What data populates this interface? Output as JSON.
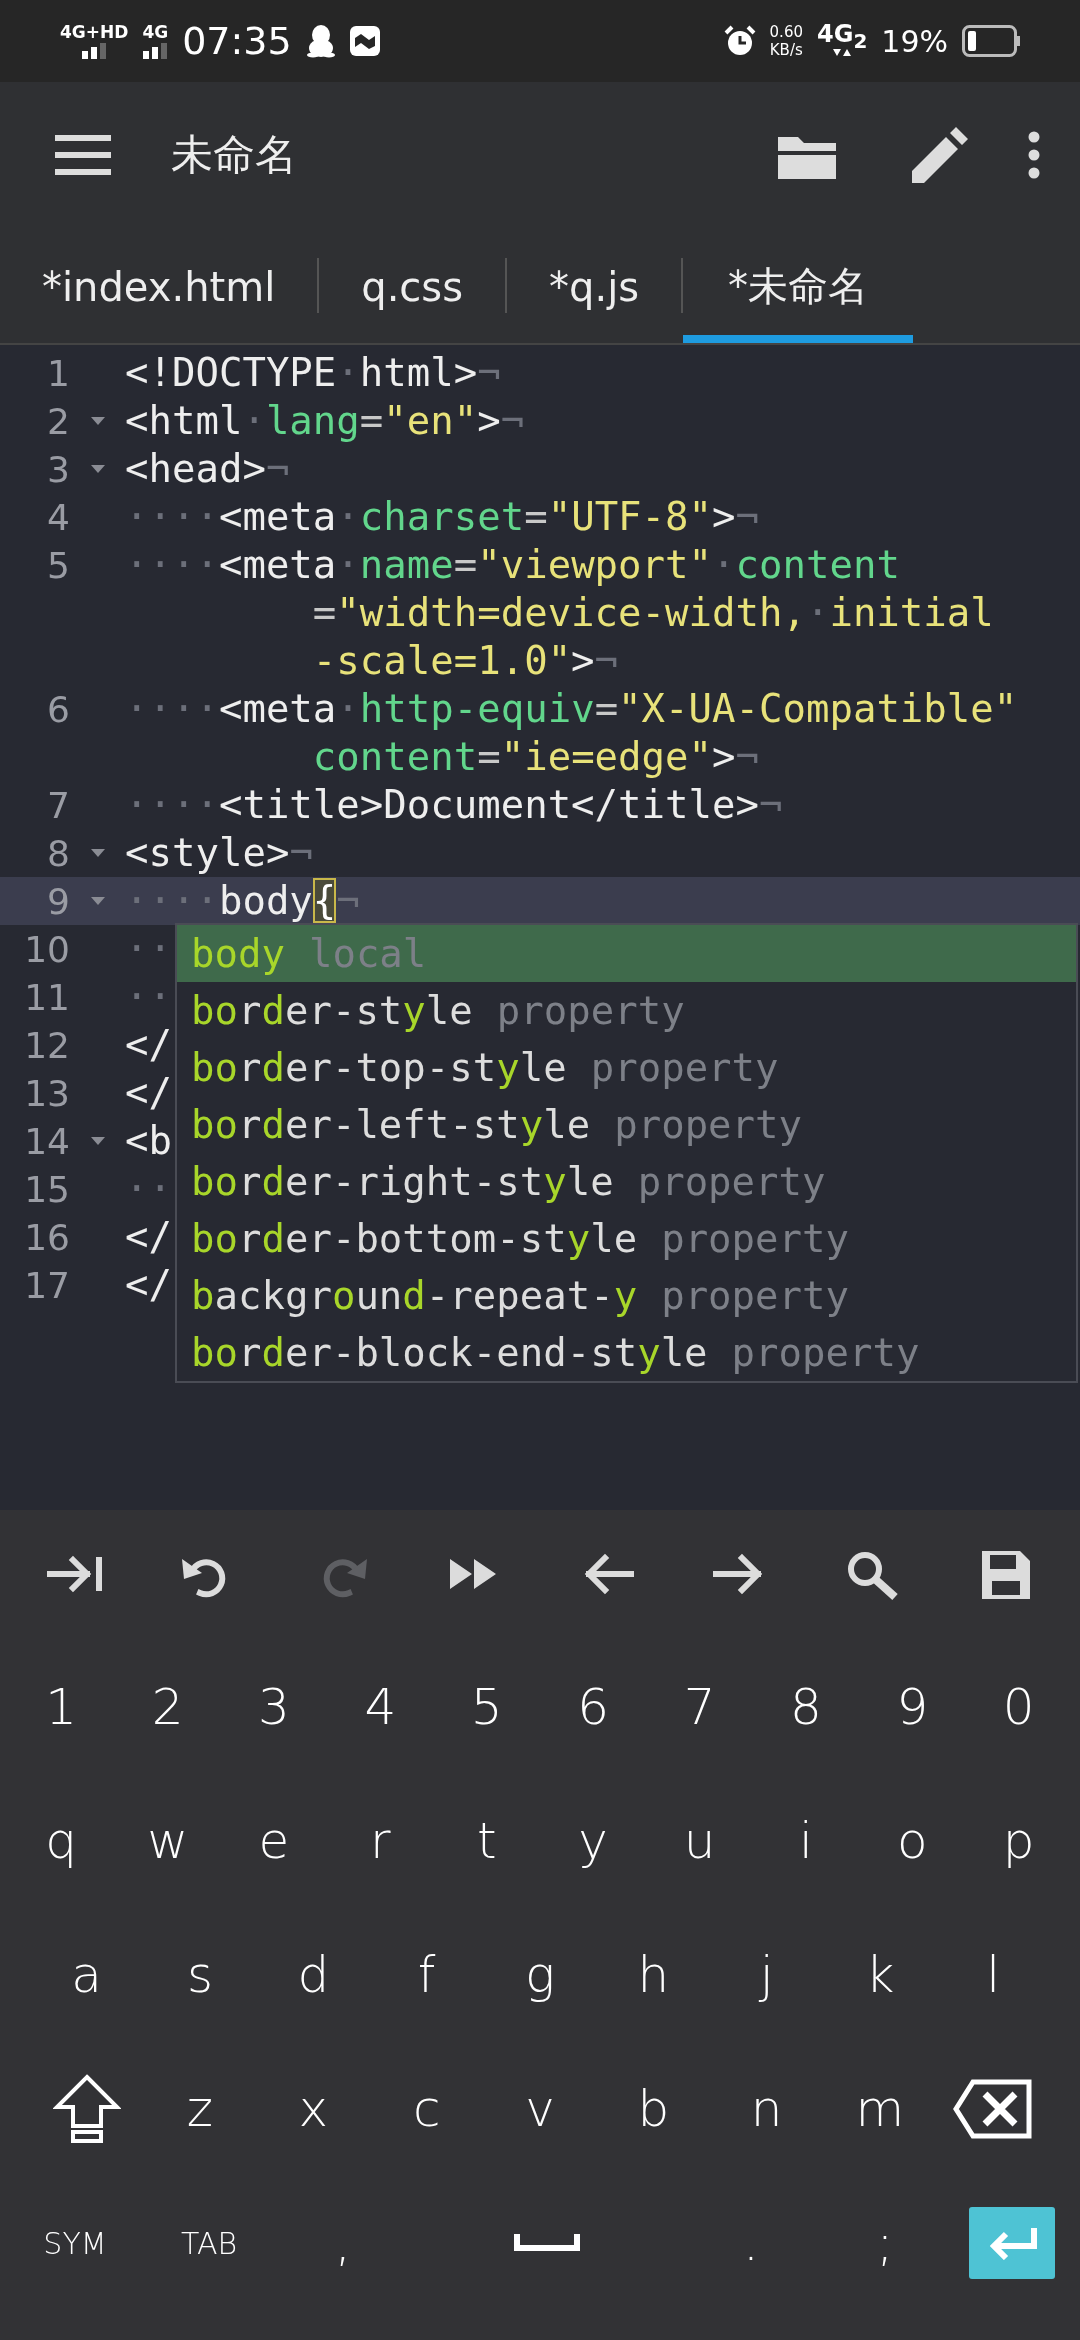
{
  "status_bar": {
    "sim1": "4G+HD",
    "sim2": "4G",
    "time": "07:35",
    "speed": "0.60",
    "speed_unit": "KB/s",
    "network": "4G$_{2}$",
    "battery": "19%"
  },
  "toolbar": {
    "title": "未命名"
  },
  "tabs": [
    {
      "label": "*index.html",
      "selected": false
    },
    {
      "label": "q.css",
      "selected": false
    },
    {
      "label": "*q.js",
      "selected": false
    },
    {
      "label": "*未命名",
      "selected": true
    }
  ],
  "editor": {
    "lines": [
      {
        "number": "1",
        "fold": false,
        "current": false,
        "rows": [
          {
            "tokens": [
              {
                "kind": "tag",
                "text": "<!DOCTYPE"
              },
              {
                "kind": "ws",
                "text": "·"
              },
              {
                "kind": "tag",
                "text": "html>"
              },
              {
                "kind": "eol",
                "text": "¬"
              }
            ]
          }
        ]
      },
      {
        "number": "2",
        "fold": true,
        "current": false,
        "rows": [
          {
            "tokens": [
              {
                "kind": "tag",
                "text": "<html"
              },
              {
                "kind": "ws",
                "text": "·"
              },
              {
                "kind": "attr",
                "text": "lang"
              },
              {
                "kind": "punct",
                "text": "="
              },
              {
                "kind": "value",
                "text": "\"en\""
              },
              {
                "kind": "tag",
                "text": ">"
              },
              {
                "kind": "eol",
                "text": "¬"
              }
            ]
          }
        ]
      },
      {
        "number": "3",
        "fold": true,
        "current": false,
        "rows": [
          {
            "tokens": [
              {
                "kind": "tag",
                "text": "<head>"
              },
              {
                "kind": "eol",
                "text": "¬"
              }
            ]
          }
        ]
      },
      {
        "number": "4",
        "fold": false,
        "current": false,
        "rows": [
          {
            "tokens": [
              {
                "kind": "ws",
                "text": "····"
              },
              {
                "kind": "tag",
                "text": "<meta"
              },
              {
                "kind": "ws",
                "text": "·"
              },
              {
                "kind": "attr",
                "text": "charset"
              },
              {
                "kind": "punct",
                "text": "="
              },
              {
                "kind": "value",
                "text": "\"UTF-8\""
              },
              {
                "kind": "tag",
                "text": ">"
              },
              {
                "kind": "eol",
                "text": "¬"
              }
            ]
          }
        ]
      },
      {
        "number": "5",
        "fold": false,
        "current": false,
        "rows": [
          {
            "tokens": [
              {
                "kind": "ws",
                "text": "····"
              },
              {
                "kind": "tag",
                "text": "<meta"
              },
              {
                "kind": "ws",
                "text": "·"
              },
              {
                "kind": "attr",
                "text": "name"
              },
              {
                "kind": "punct",
                "text": "="
              },
              {
                "kind": "value",
                "text": "\"viewport\""
              },
              {
                "kind": "ws",
                "text": "·"
              },
              {
                "kind": "attr",
                "text": "content"
              }
            ]
          },
          {
            "tokens": [
              {
                "kind": "punct",
                "text": "="
              },
              {
                "kind": "value",
                "text": "\"width=device-width,"
              },
              {
                "kind": "ws",
                "text": "·"
              },
              {
                "kind": "value",
                "text": "initial"
              }
            ]
          },
          {
            "tokens": [
              {
                "kind": "value",
                "text": "-scale=1.0\""
              },
              {
                "kind": "tag",
                "text": ">"
              },
              {
                "kind": "eol",
                "text": "¬"
              }
            ]
          }
        ]
      },
      {
        "number": "6",
        "fold": false,
        "current": false,
        "rows": [
          {
            "tokens": [
              {
                "kind": "ws",
                "text": "····"
              },
              {
                "kind": "tag",
                "text": "<meta"
              },
              {
                "kind": "ws",
                "text": "·"
              },
              {
                "kind": "attr",
                "text": "http-equiv"
              },
              {
                "kind": "punct",
                "text": "="
              },
              {
                "kind": "value",
                "text": "\"X-UA-Compatible\""
              }
            ]
          },
          {
            "tokens": [
              {
                "kind": "attr",
                "text": "content"
              },
              {
                "kind": "punct",
                "text": "="
              },
              {
                "kind": "value",
                "text": "\"ie=edge\""
              },
              {
                "kind": "tag",
                "text": ">"
              },
              {
                "kind": "eol",
                "text": "¬"
              }
            ]
          }
        ]
      },
      {
        "number": "7",
        "fold": false,
        "current": false,
        "rows": [
          {
            "tokens": [
              {
                "kind": "ws",
                "text": "····"
              },
              {
                "kind": "tag",
                "text": "<title>Document</title>"
              },
              {
                "kind": "eol",
                "text": "¬"
              }
            ]
          }
        ]
      },
      {
        "number": "8",
        "fold": true,
        "current": false,
        "rows": [
          {
            "tokens": [
              {
                "kind": "tag",
                "text": "<style>"
              },
              {
                "kind": "eol",
                "text": "¬"
              }
            ]
          }
        ]
      },
      {
        "number": "9",
        "fold": true,
        "current": true,
        "rows": [
          {
            "tokens": [
              {
                "kind": "ws",
                "text": "····"
              },
              {
                "kind": "tag",
                "text": "body"
              },
              {
                "kind": "bracket",
                "text": "{"
              },
              {
                "kind": "eol",
                "text": "¬"
              }
            ]
          }
        ]
      },
      {
        "number": "10",
        "fold": false,
        "current": false,
        "rows": [
          {
            "tokens": [
              {
                "kind": "ws",
                "text": "··"
              }
            ]
          }
        ]
      },
      {
        "number": "11",
        "fold": false,
        "current": false,
        "rows": [
          {
            "tokens": [
              {
                "kind": "ws",
                "text": "··"
              }
            ]
          }
        ]
      },
      {
        "number": "12",
        "fold": false,
        "current": false,
        "rows": [
          {
            "tokens": [
              {
                "kind": "tag",
                "text": "</"
              }
            ]
          }
        ]
      },
      {
        "number": "13",
        "fold": false,
        "current": false,
        "rows": [
          {
            "tokens": [
              {
                "kind": "tag",
                "text": "</"
              }
            ]
          }
        ]
      },
      {
        "number": "14",
        "fold": true,
        "current": false,
        "rows": [
          {
            "tokens": [
              {
                "kind": "tag",
                "text": "<b"
              }
            ]
          }
        ]
      },
      {
        "number": "15",
        "fold": false,
        "current": false,
        "rows": [
          {
            "tokens": [
              {
                "kind": "ws",
                "text": "··"
              }
            ]
          }
        ]
      },
      {
        "number": "16",
        "fold": false,
        "current": false,
        "rows": [
          {
            "tokens": [
              {
                "kind": "tag",
                "text": "</"
              }
            ]
          }
        ]
      },
      {
        "number": "17",
        "fold": false,
        "current": false,
        "rows": [
          {
            "tokens": [
              {
                "kind": "tag",
                "text": "</"
              }
            ]
          }
        ]
      }
    ]
  },
  "completions": [
    {
      "selected": true,
      "type": "local",
      "parts": [
        {
          "text": "body",
          "match": true
        }
      ]
    },
    {
      "selected": false,
      "type": "property",
      "parts": [
        {
          "text": "bo",
          "match": true
        },
        {
          "text": "r",
          "match": false
        },
        {
          "text": "d",
          "match": true
        },
        {
          "text": "er-st",
          "match": false
        },
        {
          "text": "y",
          "match": true
        },
        {
          "text": "le",
          "match": false
        }
      ]
    },
    {
      "selected": false,
      "type": "property",
      "parts": [
        {
          "text": "bo",
          "match": true
        },
        {
          "text": "r",
          "match": false
        },
        {
          "text": "d",
          "match": true
        },
        {
          "text": "er-top-st",
          "match": false
        },
        {
          "text": "y",
          "match": true
        },
        {
          "text": "le",
          "match": false
        }
      ]
    },
    {
      "selected": false,
      "type": "property",
      "parts": [
        {
          "text": "bo",
          "match": true
        },
        {
          "text": "r",
          "match": false
        },
        {
          "text": "d",
          "match": true
        },
        {
          "text": "er-left-st",
          "match": false
        },
        {
          "text": "y",
          "match": true
        },
        {
          "text": "le",
          "match": false
        }
      ]
    },
    {
      "selected": false,
      "type": "property",
      "parts": [
        {
          "text": "bo",
          "match": true
        },
        {
          "text": "r",
          "match": false
        },
        {
          "text": "d",
          "match": true
        },
        {
          "text": "er-right-st",
          "match": false
        },
        {
          "text": "y",
          "match": true
        },
        {
          "text": "le",
          "match": false
        }
      ]
    },
    {
      "selected": false,
      "type": "property",
      "parts": [
        {
          "text": "bo",
          "match": true
        },
        {
          "text": "r",
          "match": false
        },
        {
          "text": "d",
          "match": true
        },
        {
          "text": "er-bottom-st",
          "match": false
        },
        {
          "text": "y",
          "match": true
        },
        {
          "text": "le",
          "match": false
        }
      ]
    },
    {
      "selected": false,
      "type": "property",
      "parts": [
        {
          "text": "b",
          "match": true
        },
        {
          "text": "ackgr",
          "match": false
        },
        {
          "text": "o",
          "match": true
        },
        {
          "text": "un",
          "match": false
        },
        {
          "text": "d",
          "match": true
        },
        {
          "text": "-repeat-",
          "match": false
        },
        {
          "text": "y",
          "match": true
        }
      ]
    },
    {
      "selected": false,
      "type": "property",
      "parts": [
        {
          "text": "bo",
          "match": true
        },
        {
          "text": "r",
          "match": false
        },
        {
          "text": "d",
          "match": true
        },
        {
          "text": "er-block-end-st",
          "match": false
        },
        {
          "text": "y",
          "match": true
        },
        {
          "text": "le",
          "match": false
        }
      ]
    }
  ],
  "edit_keys": [
    {
      "kind": "indent",
      "disabled": false
    },
    {
      "kind": "undo",
      "disabled": false
    },
    {
      "kind": "redo",
      "disabled": true
    },
    {
      "kind": "forward",
      "disabled": false
    },
    {
      "kind": "left",
      "disabled": false
    },
    {
      "kind": "right",
      "disabled": false
    },
    {
      "kind": "search",
      "disabled": false
    },
    {
      "kind": "save",
      "disabled": false
    }
  ],
  "keyboard": {
    "rows": [
      {
        "keys": [
          {
            "kind": "char",
            "label": "1"
          },
          {
            "kind": "char",
            "label": "2"
          },
          {
            "kind": "char",
            "label": "3"
          },
          {
            "kind": "char",
            "label": "4"
          },
          {
            "kind": "char",
            "label": "5"
          },
          {
            "kind": "char",
            "label": "6"
          },
          {
            "kind": "char",
            "label": "7"
          },
          {
            "kind": "char",
            "label": "8"
          },
          {
            "kind": "char",
            "label": "9"
          },
          {
            "kind": "char",
            "label": "0"
          }
        ]
      },
      {
        "keys": [
          {
            "kind": "char",
            "label": "q"
          },
          {
            "kind": "char",
            "label": "w"
          },
          {
            "kind": "char",
            "label": "e"
          },
          {
            "kind": "char",
            "label": "r"
          },
          {
            "kind": "char",
            "label": "t"
          },
          {
            "kind": "char",
            "label": "y"
          },
          {
            "kind": "char",
            "label": "u"
          },
          {
            "kind": "char",
            "label": "i"
          },
          {
            "kind": "char",
            "label": "o"
          },
          {
            "kind": "char",
            "label": "p"
          }
        ]
      },
      {
        "keys": [
          {
            "kind": "char",
            "label": "a"
          },
          {
            "kind": "char",
            "label": "s"
          },
          {
            "kind": "char",
            "label": "d"
          },
          {
            "kind": "char",
            "label": "f"
          },
          {
            "kind": "char",
            "label": "g"
          },
          {
            "kind": "char",
            "label": "h"
          },
          {
            "kind": "char",
            "label": "j"
          },
          {
            "kind": "char",
            "label": "k"
          },
          {
            "kind": "char",
            "label": "l"
          }
        ]
      },
      {
        "keys": [
          {
            "kind": "shift"
          },
          {
            "kind": "char",
            "label": "z"
          },
          {
            "kind": "char",
            "label": "x"
          },
          {
            "kind": "char",
            "label": "c"
          },
          {
            "kind": "char",
            "label": "v"
          },
          {
            "kind": "char",
            "label": "b"
          },
          {
            "kind": "char",
            "label": "n"
          },
          {
            "kind": "char",
            "label": "m"
          },
          {
            "kind": "backspace"
          }
        ]
      },
      {
        "keys": [
          {
            "kind": "small",
            "label": "SYM"
          },
          {
            "kind": "small",
            "label": "TAB"
          },
          {
            "kind": "char",
            "label": ","
          },
          {
            "kind": "space"
          },
          {
            "kind": "char",
            "label": "."
          },
          {
            "kind": "char",
            "label": ";"
          },
          {
            "kind": "enter"
          }
        ]
      }
    ]
  }
}
